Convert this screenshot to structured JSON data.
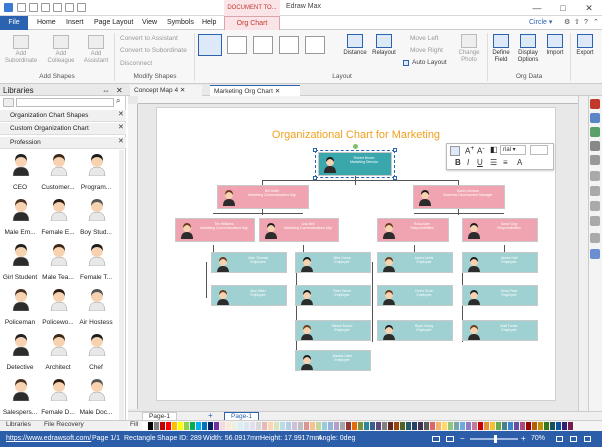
{
  "titlebar": {
    "doc_tab": "DOCUMENT TO...",
    "app_title": "Edraw Max",
    "min": "—",
    "max": "□",
    "close": "✕"
  },
  "menu": {
    "file": "File",
    "home": "Home",
    "insert": "Insert",
    "page_layout": "Page Layout",
    "view": "View",
    "symbols": "Symbols",
    "help": "Help",
    "org_chart": "Org Chart",
    "circle": "Circle"
  },
  "ribbon": {
    "add_subordinate": "Add Subordinate",
    "add_colleague": "Add Colleague",
    "add_assistant": "Add Assistant",
    "group_add_shapes": "Add Shapes",
    "convert_assistant": "Convert to Assistant",
    "convert_subordinate": "Convert to Subordinate",
    "disconnect": "Disconnect",
    "group_modify": "Modify Shapes",
    "distance": "Distance",
    "relayout": "Relayout",
    "move_left": "Move Left",
    "move_right": "Move Right",
    "auto_layout": "Auto Layout",
    "change_photo": "Change Photo",
    "group_layout": "Layout",
    "define_field": "Define Field",
    "display_options": "Display Options",
    "import": "Import",
    "export": "Export",
    "group_org_data": "Org Data"
  },
  "doc_tabs": [
    {
      "label": "Concept Map 4"
    },
    {
      "label": "Marketing Org Chart"
    }
  ],
  "libraries": {
    "title": "Libraries",
    "sections": [
      "Organization Chart Shapes",
      "Custom Organization Chart",
      "Profession"
    ],
    "items": [
      "CEO",
      "Customer...",
      "Program...",
      "Male Em...",
      "Female E...",
      "Boy Stud...",
      "Girl Student",
      "Male Tea...",
      "Female T...",
      "Policeman",
      "Policewo...",
      "Air Hostess",
      "Detective",
      "Architect",
      "Chef",
      "Salespers...",
      "Female D...",
      "Male Doc..."
    ]
  },
  "chart": {
    "title": "Organizational Chart for Marketing",
    "text_toolbar": {
      "font": "rial"
    },
    "nodes": [
      {
        "name": "Robert Brown",
        "title": "Marketing Director",
        "style": "sel"
      },
      {
        "name": "Bill Smith",
        "title": "Marketing Communications Mgr",
        "style": "pink"
      },
      {
        "name": "David Johnson",
        "title": "Business Development Manager",
        "style": "pink"
      },
      {
        "name": "Tim Williams",
        "title": "Marketing Communications Mgr",
        "style": "pink"
      },
      {
        "name": "Lisa Bell",
        "title": "Marketing Communications Mgr",
        "style": "pink"
      },
      {
        "name": "Rosa Allen",
        "title": "Responsibilities",
        "style": "pink"
      },
      {
        "name": "Sarah Clay",
        "title": "Responsibilities",
        "style": "pink"
      },
      {
        "name": "John Thomas",
        "title": "Employee",
        "style": "teal"
      },
      {
        "name": "Mike Jones",
        "title": "Employee",
        "style": "teal"
      },
      {
        "name": "Aaron Lewis",
        "title": "Employee",
        "style": "teal"
      },
      {
        "name": "James Hall",
        "title": "Employee",
        "style": "teal"
      },
      {
        "name": "Amy Miller",
        "title": "Employee",
        "style": "teal"
      },
      {
        "name": "Peter Wood",
        "title": "Employee",
        "style": "teal"
      },
      {
        "name": "Kevin Scott",
        "title": "Employee",
        "style": "teal"
      },
      {
        "name": "Anna Price",
        "title": "Employee",
        "style": "teal"
      },
      {
        "name": "Steven Moore",
        "title": "Employee",
        "style": "teal"
      },
      {
        "name": "Ryan Young",
        "title": "Employee",
        "style": "teal"
      },
      {
        "name": "Matt Turner",
        "title": "Employee",
        "style": "teal"
      },
      {
        "name": "Jessica Clark",
        "title": "Employee",
        "style": "teal"
      }
    ]
  },
  "pages": {
    "page_tab": "Page-1",
    "page_tab_active": "Page-1",
    "add": "+"
  },
  "bottom": {
    "libraries_tab": "Libraries",
    "file_recovery_tab": "File Recovery",
    "fill_label": "Fill"
  },
  "status": {
    "url": "https://www.edrawsoft.com/",
    "page": "Page 1/1",
    "shape": "Rectangle",
    "shape_id": "Shape ID: 289",
    "width": "Width: 56.0917mm",
    "height": "Height: 17.9917mm",
    "angle": "Angle: 0deg",
    "zoom": "70%"
  },
  "palette": [
    "#ffffff",
    "#000000",
    "#7f7f7f",
    "#c00000",
    "#ff0000",
    "#ffc000",
    "#ffff00",
    "#92d050",
    "#00b050",
    "#00b0f0",
    "#0070c0",
    "#002060",
    "#7030a0",
    "#f2dcdb",
    "#fde9d9",
    "#ebf1de",
    "#dbeef3",
    "#dce6f1",
    "#e4dfec",
    "#d9d9d9",
    "#e6b8b7",
    "#fcd5b4",
    "#d8e4bc",
    "#b7dee8",
    "#b8cce4",
    "#ccc0da",
    "#bfbfbf",
    "#da9694",
    "#fabf8f",
    "#c4d79b",
    "#92cddc",
    "#95b3d7",
    "#b1a0c7",
    "#a6a6a6",
    "#963634",
    "#e26b0a",
    "#76933c",
    "#31869b",
    "#366092",
    "#60497a",
    "#808080",
    "#632523",
    "#974706",
    "#4f6228",
    "#215967",
    "#244062",
    "#403151",
    "#595959",
    "#e06666",
    "#f6b26b",
    "#ffd966",
    "#93c47d",
    "#76a5af",
    "#6fa8dc",
    "#8e7cc3",
    "#c27ba0",
    "#cc0000",
    "#e69138",
    "#f1c232",
    "#6aa84f",
    "#45818e",
    "#3d85c6",
    "#674ea7",
    "#a64d79",
    "#990000",
    "#b45f06",
    "#bf9000",
    "#38761d",
    "#134f5c",
    "#0b5394",
    "#351c75",
    "#741b47"
  ]
}
